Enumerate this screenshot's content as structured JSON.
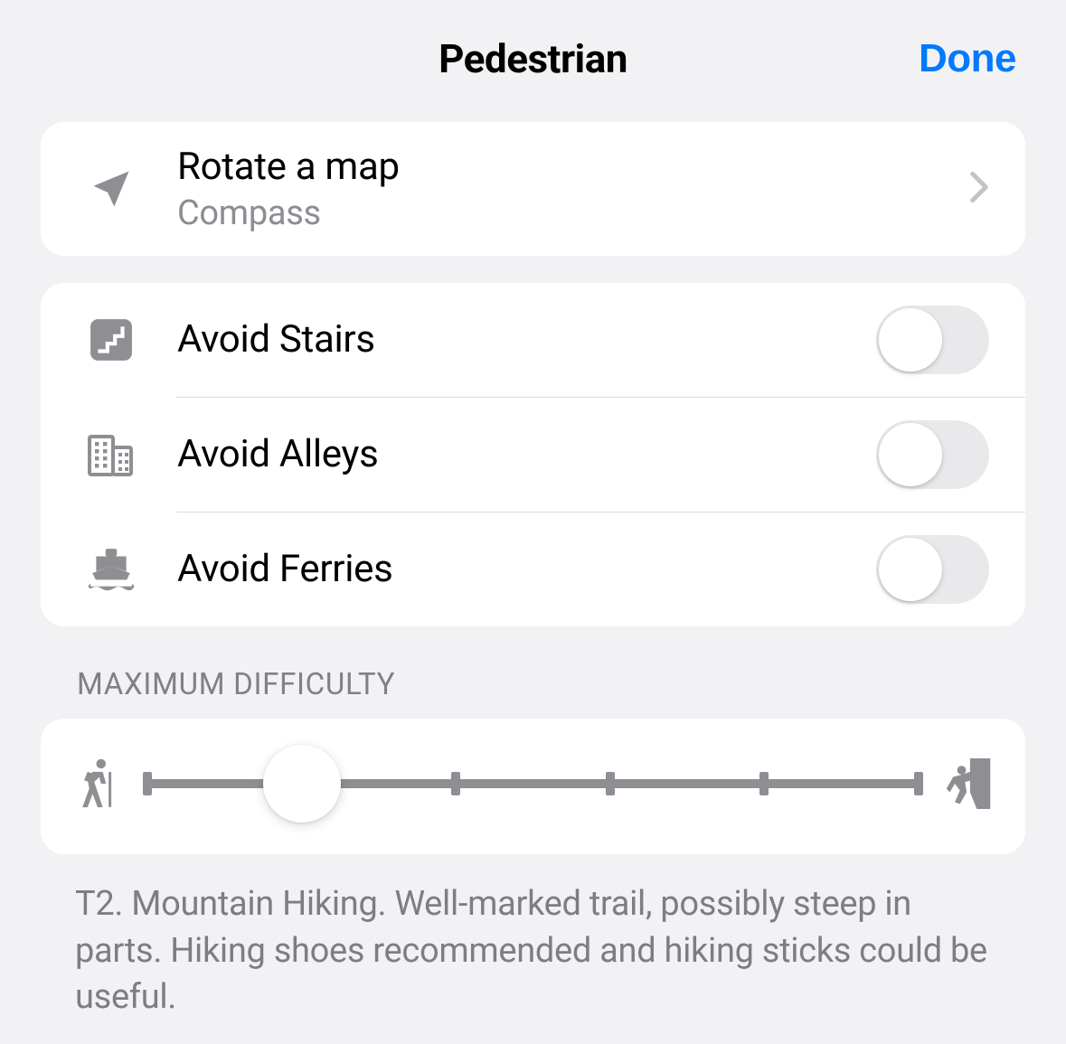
{
  "header": {
    "title": "Pedestrian",
    "done": "Done"
  },
  "rotate": {
    "title": "Rotate a map",
    "subtitle": "Compass"
  },
  "avoid_stairs": {
    "label": "Avoid Stairs",
    "on": false
  },
  "avoid_alleys": {
    "label": "Avoid Alleys",
    "on": false
  },
  "avoid_ferries": {
    "label": "Avoid Ferries",
    "on": false
  },
  "difficulty": {
    "section_label": "MAXIMUM DIFFICULTY",
    "steps": 6,
    "value": 1,
    "description": "T2. Mountain Hiking. Well-marked trail, possibly steep in parts. Hiking shoes recommended and hiking sticks could be useful."
  }
}
